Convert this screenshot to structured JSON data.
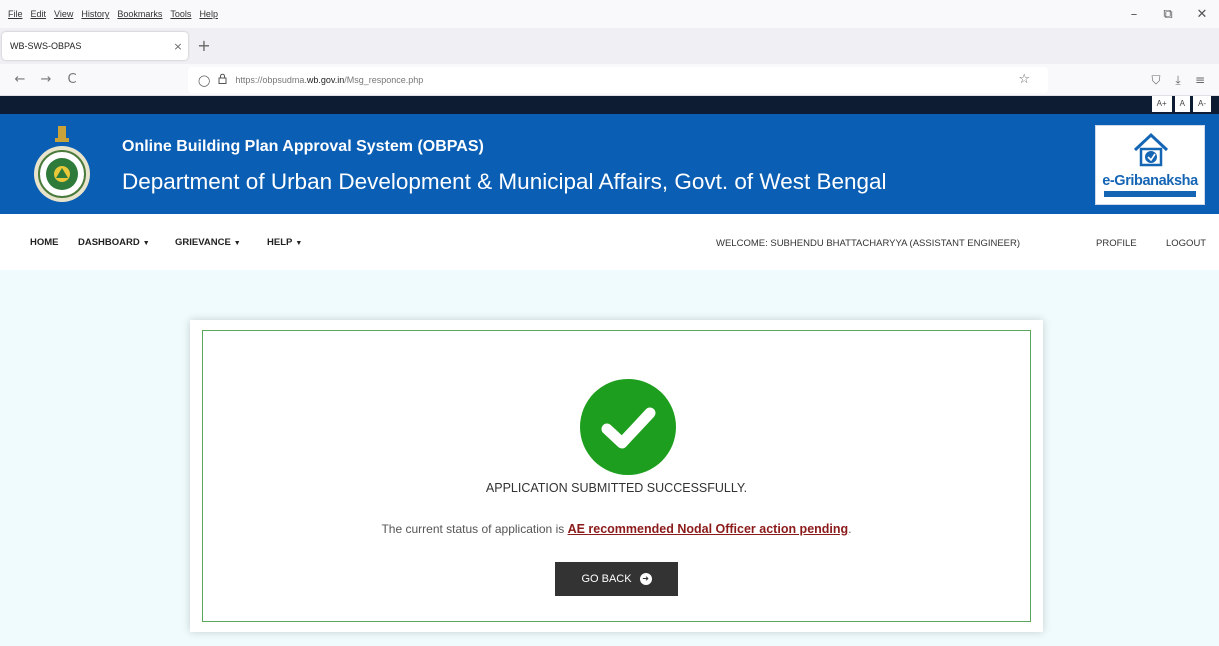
{
  "browser": {
    "menu": [
      "File",
      "Edit",
      "View",
      "History",
      "Bookmarks",
      "Tools",
      "Help"
    ],
    "window_controls": {
      "minimize": "–",
      "restore": "⧉",
      "close": "✕"
    },
    "tab": {
      "title": "WB-SWS-OBPAS",
      "close": "×"
    },
    "new_tab": "+",
    "nav": {
      "back": "←",
      "forward": "→",
      "reload": "C"
    },
    "url": {
      "prefix": "https://obpsudma.",
      "domain": "wb.gov.in",
      "path": "/Msg_responce.php"
    },
    "icons": {
      "shield": "◯",
      "lock": "🔒",
      "star": "☆",
      "pocket": "⛉",
      "download": "⤓",
      "menu": "≡"
    }
  },
  "site": {
    "font_sizes": [
      "A+",
      "A",
      "A-"
    ],
    "title": "Online Building Plan Approval System (OBPAS)",
    "subtitle": "Department of Urban Development & Municipal Affairs, Govt. of West Bengal",
    "brand": "e-Gribanaksha",
    "brand_color": "#1565b5",
    "banner_color": "#0a5eb4"
  },
  "nav": {
    "home": "HOME",
    "dashboard": "DASHBOARD",
    "grievance": "GRIEVANCE",
    "help": "HELP",
    "caret": "▼",
    "welcome": "WELCOME: SUBHENDU BHATTACHARYYA (ASSISTANT ENGINEER)",
    "profile": "PROFILE",
    "logout": "LOGOUT"
  },
  "result": {
    "message": "APPLICATION SUBMITTED SUCCESSFULLY.",
    "status_prefix": "The current status of application is ",
    "status_value": "AE recommended Nodal Officer action pending",
    "status_suffix": ".",
    "button": "GO BACK",
    "button_icon": "➜",
    "success_color": "#1e9e1e"
  }
}
